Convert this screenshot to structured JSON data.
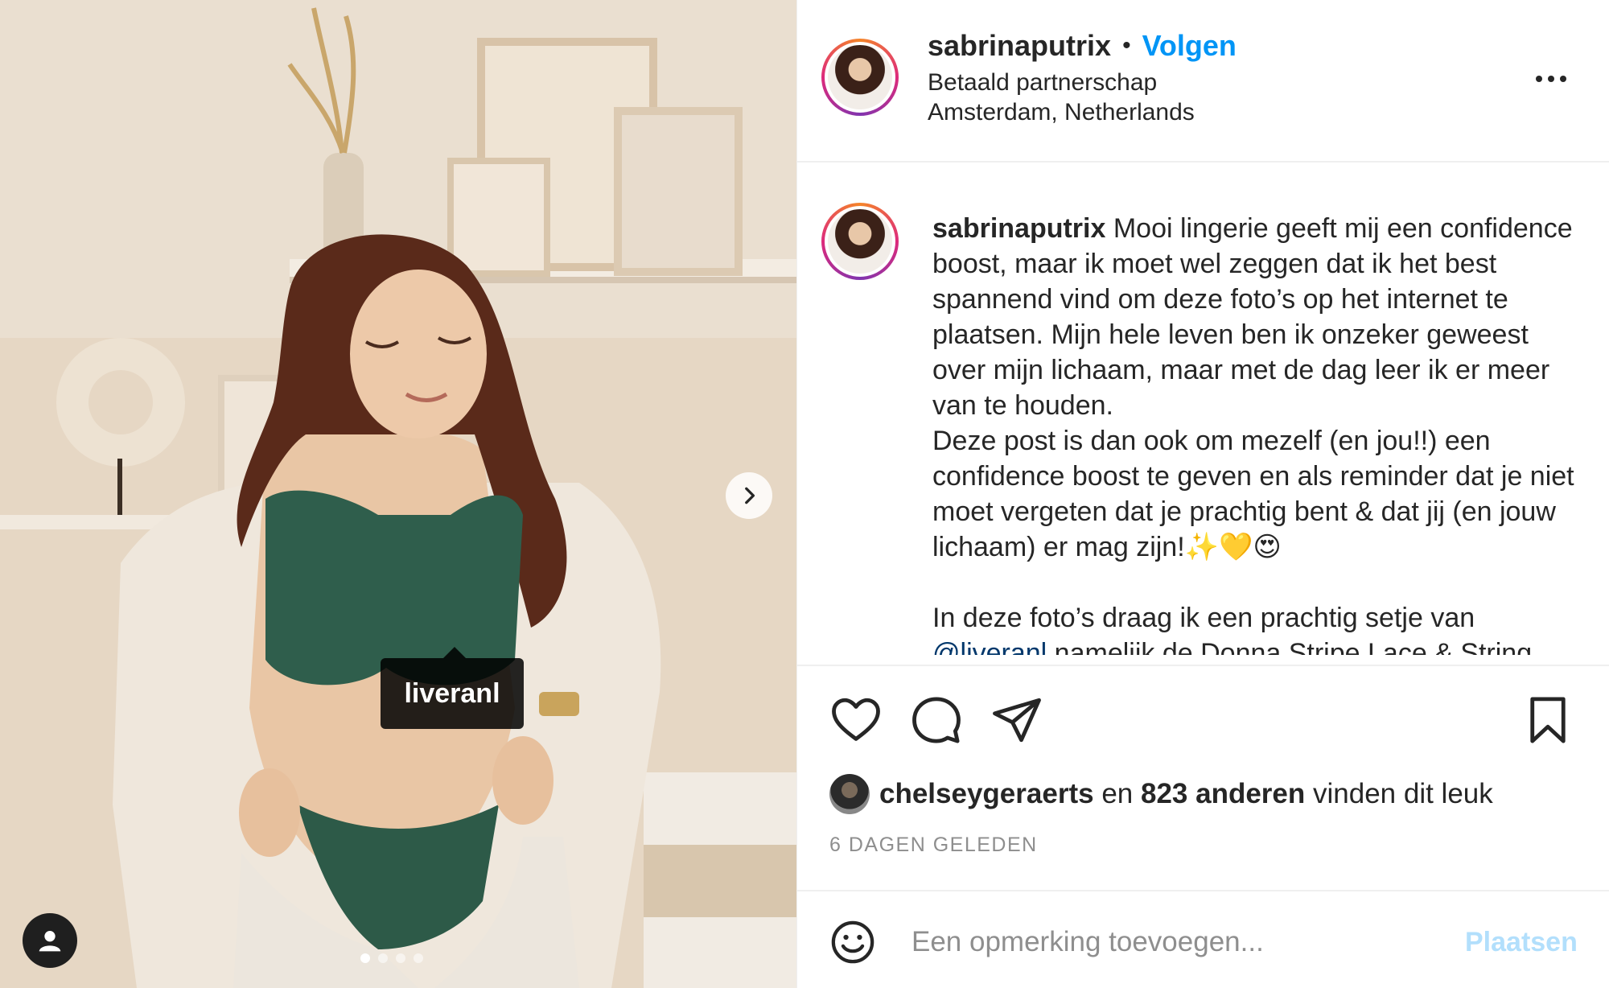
{
  "photo": {
    "tag_label": "liveranl",
    "carousel": {
      "count": 4,
      "active": 1
    },
    "icons": {
      "next": "chevron-right-icon",
      "user_tags": "user-icon"
    }
  },
  "header": {
    "username": "sabrinaputrix",
    "separator": "•",
    "follow_label": "Volgen",
    "subtitle": "Betaald partnerschap",
    "location": "Amsterdam, Netherlands",
    "more_icon": "more-horizontal-icon"
  },
  "caption": {
    "username": "sabrinaputrix",
    "text_1": "Mooi lingerie geeft mij een confidence boost, maar ik moet wel zeggen dat ik het best spannend vind om deze foto’s op het internet te plaatsen. Mijn hele leven ben ik onzeker geweest over mijn lichaam, maar met de dag leer ik er meer van te houden.\nDeze post is dan ook om mezelf (en jou!!) een confidence boost te geven en als reminder dat je niet moet vergeten dat je prachtig bent & dat jij (en jouw lichaam) er mag zijn!✨💛😍\n\nIn deze foto’s draag ik een prachtig setje van\n",
    "mention": "@liveranl",
    "text_2": " nameliik de Donna Stripe Lace & String"
  },
  "actions": {
    "icons": [
      "heart-icon",
      "comment-icon",
      "share-icon",
      "bookmark-icon"
    ]
  },
  "likes": {
    "liker": "chelseygeraerts",
    "connector": "en",
    "others": "823 anderen",
    "suffix": "vinden dit leuk"
  },
  "date": "6 DAGEN GELEDEN",
  "comment": {
    "placeholder": "Een opmerking toevoegen...",
    "post_label": "Plaatsen",
    "emoji_icon": "smiley-icon"
  },
  "colors": {
    "link": "#0095f6",
    "post_disabled": "#b2dffc",
    "text": "#262626",
    "muted": "#8e8e8e"
  }
}
